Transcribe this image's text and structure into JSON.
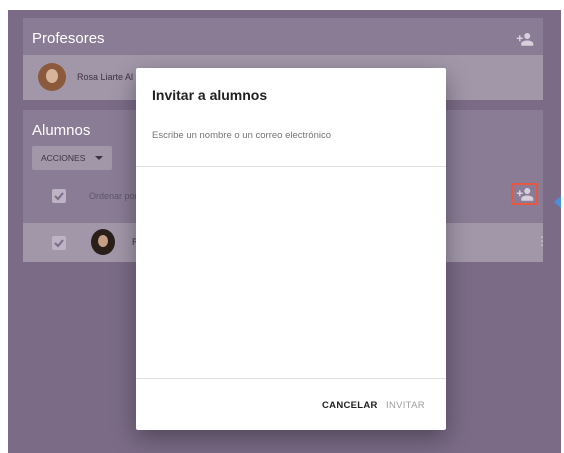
{
  "teachers": {
    "title": "Profesores",
    "add_icon": "person-add-icon",
    "items": [
      {
        "name": "Rosa Liarte Al"
      }
    ]
  },
  "students": {
    "title": "Alumnos",
    "actions_label": "ACCIONES",
    "sort_label": "Ordenar por",
    "add_icon": "person-add-icon",
    "highlight_color": "#e8573f",
    "items": [
      {
        "name": "Roc"
      }
    ]
  },
  "dialog": {
    "title": "Invitar a alumnos",
    "search_placeholder": "Escribe un nombre o un correo electrónico",
    "cancel_label": "CANCELAR",
    "invite_label": "INVITAR"
  },
  "colors": {
    "overlay": "#7b6b86",
    "panel": "#8a7c95",
    "dialog": "#ffffff",
    "accent_arrow": "#4a90d9"
  }
}
